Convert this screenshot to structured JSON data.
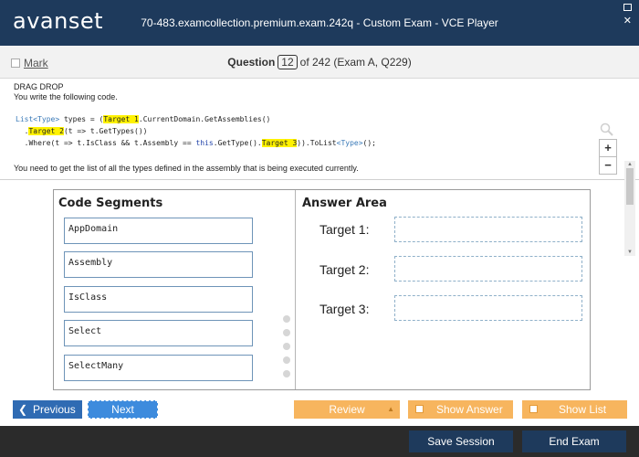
{
  "titlebar": {
    "logo": "avanset",
    "title": "70-483.examcollection.premium.exam.242q - Custom Exam - VCE Player"
  },
  "header": {
    "mark_label": "Mark",
    "question_label": "Question",
    "question_number": "12",
    "question_of": "of 242 (Exam A, Q229)"
  },
  "question": {
    "type": "DRAG DROP",
    "intro": "You write the following code.",
    "code": {
      "line1_type": "List<Type>",
      "line1_a": " types = (",
      "line1_target": "Target 1",
      "line1_b": ".CurrentDomain.GetAssemblies()",
      "line2_a": "  .",
      "line2_target": "Target 2",
      "line2_b": "(t => t.GetTypes())",
      "line3_a": "  .Where(t => t.IsClass && t.Assembly == ",
      "line3_kw": "this",
      "line3_b": ".GetType().",
      "line3_target": "Target 3",
      "line3_c": ")).ToList",
      "line3_gen": "<Type>",
      "line3_d": "();"
    },
    "task": "You need to get the list of all the types defined in the assembly that is being executed currently."
  },
  "zoom": {
    "in_label": "+",
    "out_label": "−"
  },
  "exhibit": {
    "segments_title": "Code Segments",
    "segments": [
      "AppDomain",
      "Assembly",
      "IsClass",
      "Select",
      "SelectMany"
    ],
    "answer_title": "Answer Area",
    "targets": [
      "Target 1:",
      "Target 2:",
      "Target 3:"
    ]
  },
  "nav": {
    "previous_label": "Previous",
    "next_label": "Next",
    "review_label": "Review",
    "show_answer_label": "Show Answer",
    "show_list_label": "Show List"
  },
  "bottom": {
    "save_session_label": "Save Session",
    "end_exam_label": "End Exam"
  },
  "colors": {
    "titlebar_bg": "#1e3a5c",
    "previous_bg": "#2f6bb3",
    "next_bg": "#3d8bdd",
    "orange_button": "#f7b55e",
    "highlight": "#fff200",
    "bottom_bar": "#2b2b2b"
  },
  "icons": [
    "maximize-icon",
    "close-icon",
    "magnifier-icon",
    "chevron-left-icon",
    "triangle-up-icon"
  ]
}
